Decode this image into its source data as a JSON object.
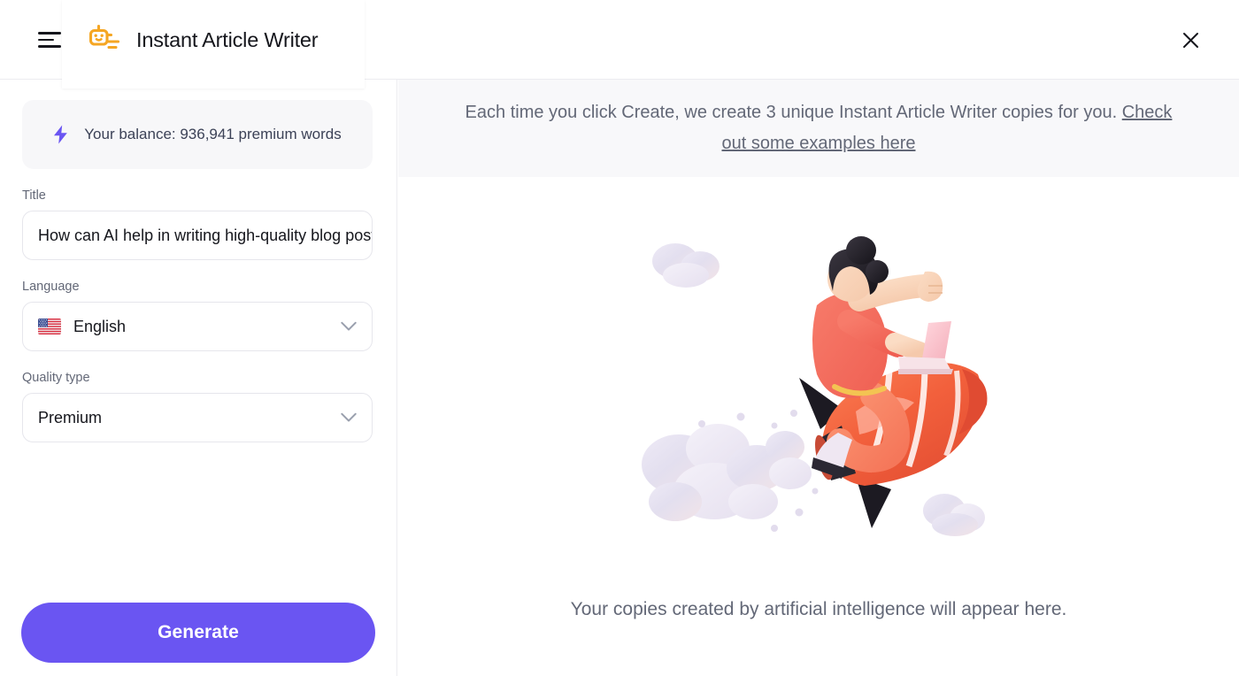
{
  "header": {
    "menu_icon": "hamburger-menu-icon",
    "logo_icon": "robot-writer-logo-icon",
    "title": "Instant Article Writer",
    "close_icon": "close-icon"
  },
  "left_panel": {
    "balance": {
      "icon": "lightning-bolt-icon",
      "text": "Your balance: 936,941 premium words"
    },
    "fields": [
      {
        "name": "title",
        "label": "Title",
        "type": "text",
        "value": "How can AI help in writing high-quality blog posts",
        "placeholder": "Title"
      },
      {
        "name": "language",
        "label": "Language",
        "type": "select",
        "value": "English",
        "flag": "us-flag-icon",
        "chevron": "chevron-down-icon"
      },
      {
        "name": "quality_type",
        "label": "Quality type",
        "type": "select",
        "value": "Premium",
        "chevron": "chevron-down-icon"
      }
    ],
    "generate_button": "Generate"
  },
  "right_panel": {
    "banner": {
      "text_before": "Each time you click Create, we create 3 unique Instant Article Writer copies for you. ",
      "link_text": "Check out some examples here"
    },
    "illustration": "person-riding-rocket-with-laptop-illustration",
    "empty_state_text": "Your copies created by artificial intelligence will appear here."
  },
  "colors": {
    "accent_purple": "#6a55f2",
    "logo_orange": "#f5a623",
    "panel_bg": "#f8f8fa",
    "card_bg": "#f7f7f9",
    "text_dark": "#15161c",
    "text_muted": "#636877",
    "border": "#e6e6ec"
  }
}
